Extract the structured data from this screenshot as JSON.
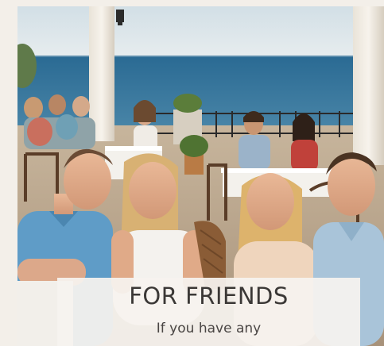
{
  "card": {
    "title": "FOR FRIENDS",
    "text": "If you have any"
  },
  "photo": {
    "subject": "friends-dining-at-seaside-terrace"
  },
  "colors": {
    "page_background": "#f3efe9",
    "card_background": "#f6f3ef",
    "title_text": "#3b3836",
    "body_text": "#4a4644",
    "sea": "#2f6f97",
    "sky": "#dce6ea"
  }
}
